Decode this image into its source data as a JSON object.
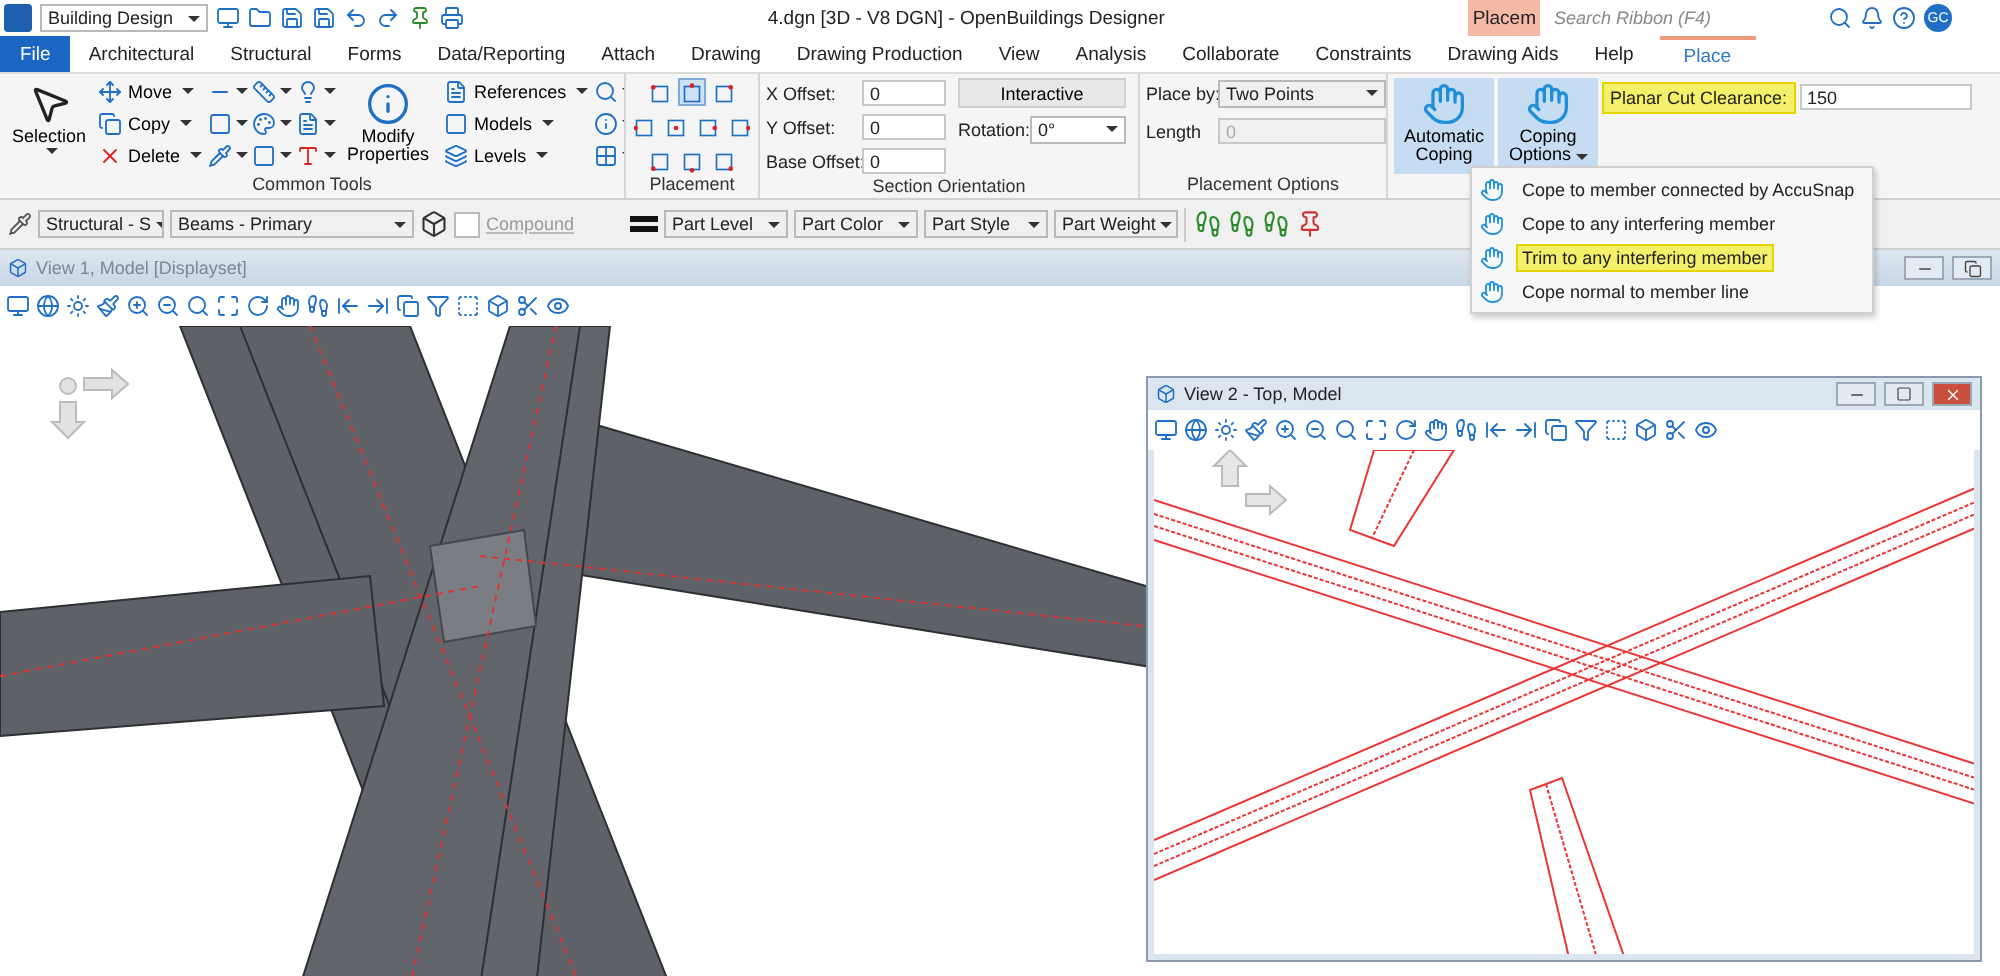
{
  "title_bar": {
    "workflow": "Building Design",
    "title": "4.dgn [3D - V8 DGN] - OpenBuildings Designer",
    "context_tab": "Placem",
    "search": {
      "placeholder": "Search Ribbon (F4)"
    },
    "user": "GC"
  },
  "tabs": [
    {
      "label": "File",
      "kind": "file",
      "selected": false
    },
    {
      "label": "Architectural",
      "kind": "tab",
      "selected": false
    },
    {
      "label": "Structural",
      "kind": "tab",
      "selected": false
    },
    {
      "label": "Forms",
      "kind": "tab",
      "selected": false
    },
    {
      "label": "Data/Reporting",
      "kind": "tab",
      "selected": false
    },
    {
      "label": "Attach",
      "kind": "tab",
      "selected": false
    },
    {
      "label": "Drawing",
      "kind": "tab",
      "selected": false
    },
    {
      "label": "Drawing Production",
      "kind": "tab",
      "selected": false
    },
    {
      "label": "View",
      "kind": "tab",
      "selected": false
    },
    {
      "label": "Analysis",
      "kind": "tab",
      "selected": false
    },
    {
      "label": "Collaborate",
      "kind": "tab",
      "selected": false
    },
    {
      "label": "Constraints",
      "kind": "tab",
      "selected": false
    },
    {
      "label": "Drawing Aids",
      "kind": "tab",
      "selected": false
    },
    {
      "label": "Help",
      "kind": "tab",
      "selected": false
    },
    {
      "label": "Place",
      "kind": "context",
      "selected": true
    }
  ],
  "common_tools": {
    "label": "Common Tools",
    "selection": "Selection",
    "edit_items": [
      "Move",
      "Copy",
      "Delete"
    ],
    "modify": "Modify Properties",
    "attach_items": [
      "References",
      "Models",
      "Levels"
    ]
  },
  "placement": {
    "label": "Placement",
    "points": [
      {
        "selected": false
      },
      {
        "selected": true
      },
      {
        "selected": false
      },
      {
        "selected": false
      },
      {
        "selected": false
      },
      {
        "selected": false
      },
      {
        "selected": false
      },
      {
        "selected": false
      },
      {
        "selected": false
      },
      {
        "selected": false
      }
    ]
  },
  "section_orientation": {
    "label": "Section Orientation",
    "fields": [
      {
        "label": "X Offset:",
        "value": "0"
      },
      {
        "label": "Y Offset:",
        "value": "0"
      },
      {
        "label": "Base Offset:",
        "value": "0"
      }
    ],
    "mode": "Interactive",
    "rotation_label": "Rotation:",
    "rotation": "0°"
  },
  "placement_options": {
    "label": "Placement Options",
    "place_by_label": "Place by:",
    "place_by": "Two Points",
    "length_label": "Length",
    "length": "0",
    "length_disabled": true
  },
  "coping": {
    "buttons": [
      {
        "label": "Automatic Coping",
        "selected": true,
        "kind": "plain"
      },
      {
        "label": "Coping Options",
        "selected": true,
        "kind": "dropdown"
      }
    ],
    "clearance": {
      "label": "Planar Cut Clearance:",
      "value": "150",
      "highlighted": true
    }
  },
  "attribute_toolbar": {
    "family": "Structural - S",
    "part": "Beams - Primary",
    "compound": {
      "label": "Compound",
      "checked": false
    },
    "dropdowns": [
      "Part Level",
      "Part Color",
      "Part Style",
      "Part Weight"
    ]
  },
  "view1": {
    "title": "View 1, Model [Displayset]"
  },
  "view2": {
    "title": "View 2 - Top, Model"
  },
  "coping_menu": [
    {
      "label": "Cope to member connected by AccuSnap",
      "highlighted": false
    },
    {
      "label": "Cope to any interfering member",
      "highlighted": false
    },
    {
      "label": "Trim to any interfering member",
      "highlighted": true
    },
    {
      "label": "Cope normal to member line",
      "highlighted": false
    }
  ]
}
